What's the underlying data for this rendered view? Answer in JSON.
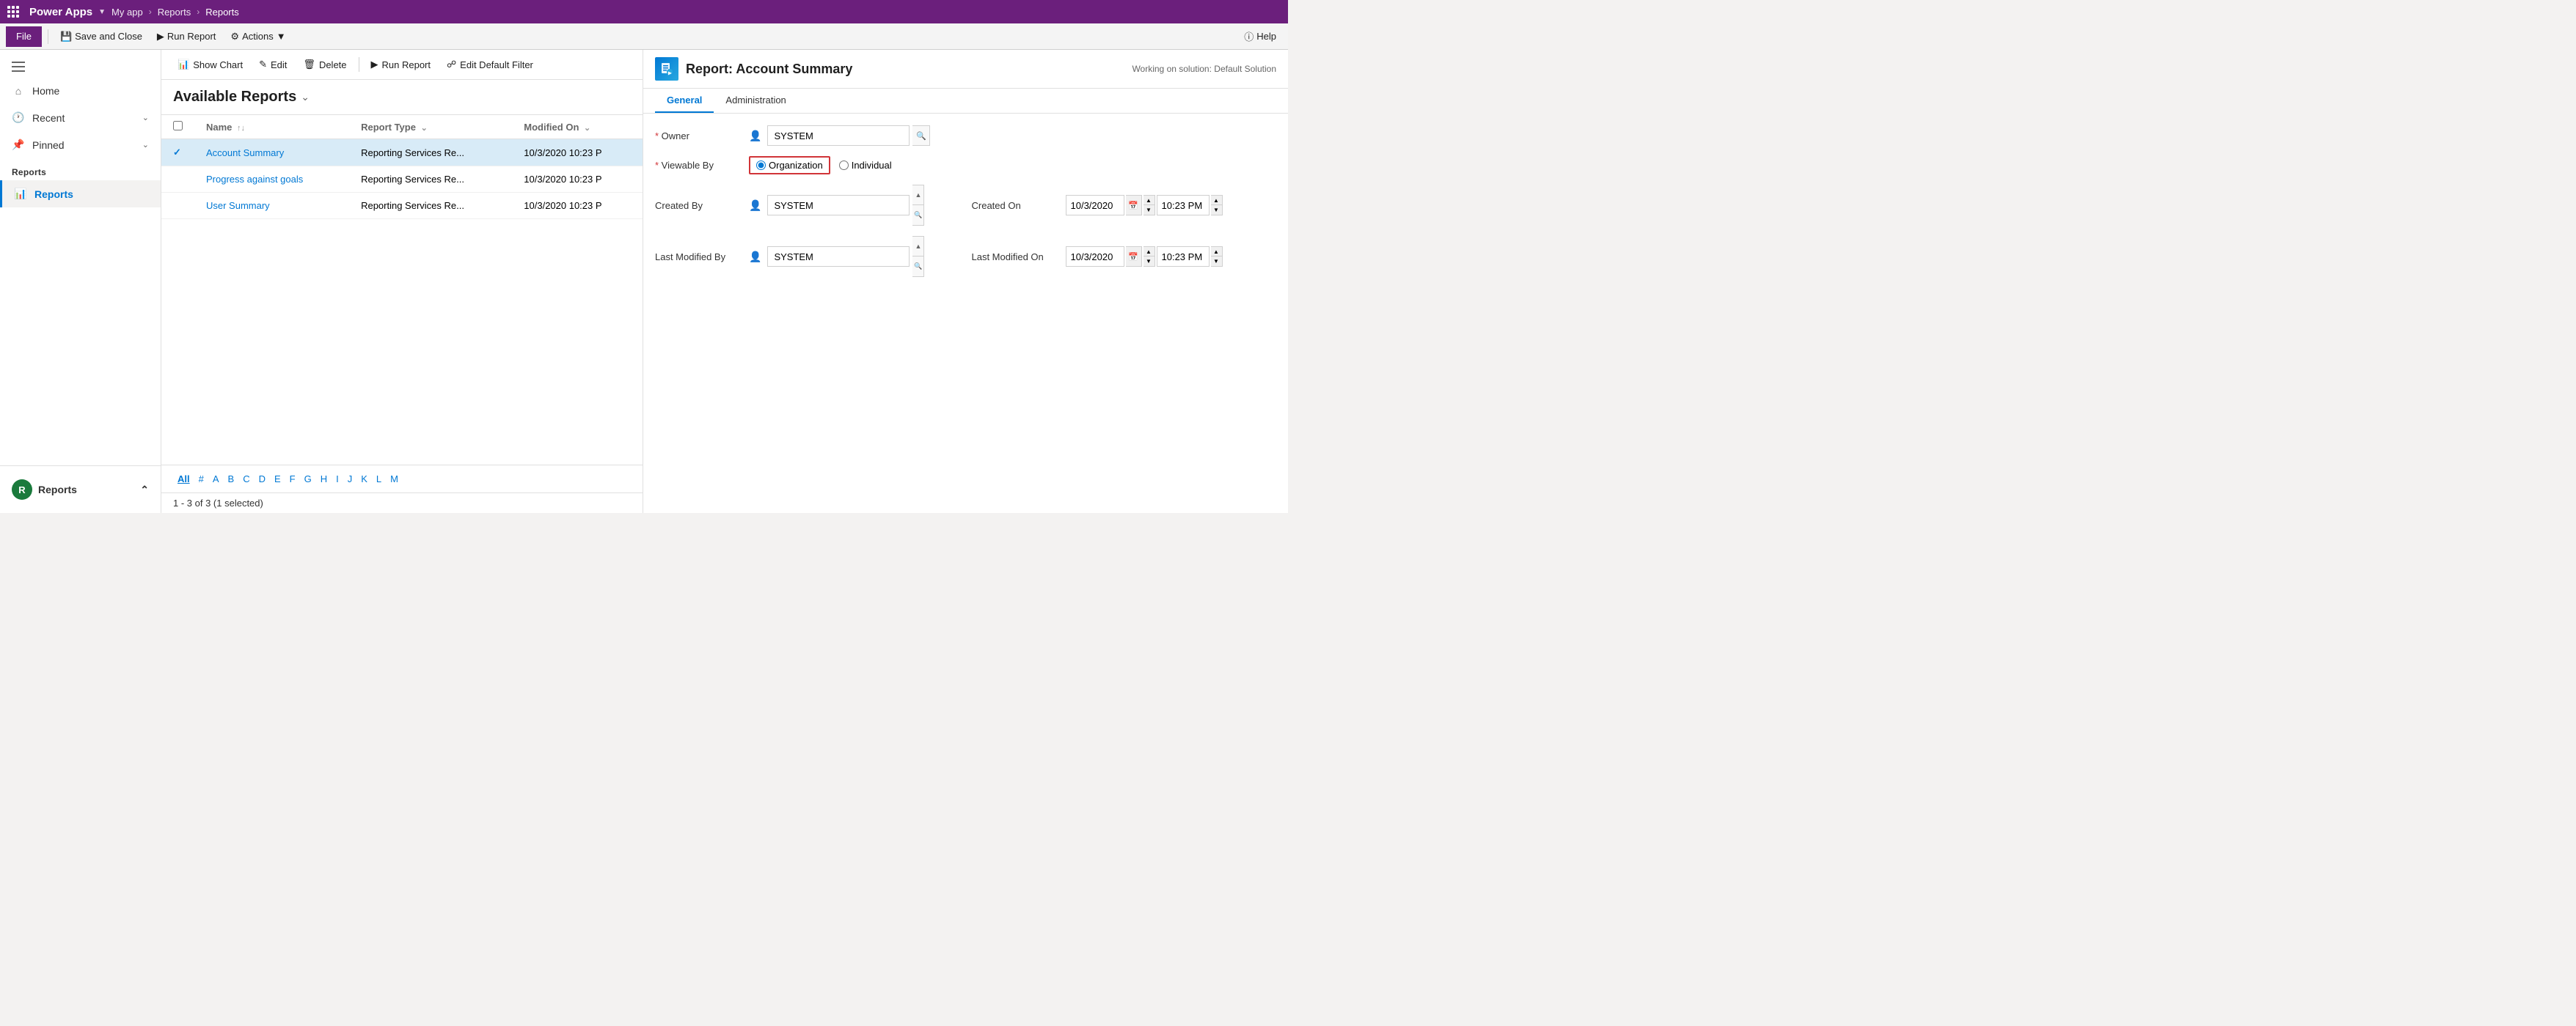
{
  "topNav": {
    "appName": "Power Apps",
    "myApp": "My app",
    "breadcrumb1": "Reports",
    "breadcrumb2": "Reports"
  },
  "toolbar": {
    "fileLabel": "File",
    "saveAndClose": "Save and Close",
    "runReport": "Run Report",
    "actions": "Actions",
    "helpLabel": "Help"
  },
  "listToolbar": {
    "showChart": "Show Chart",
    "edit": "Edit",
    "delete": "Delete",
    "runReport": "Run Report",
    "editDefaultFilter": "Edit Default Filter"
  },
  "tableSection": {
    "title": "Available Reports",
    "columns": {
      "name": "Name",
      "reportType": "Report Type",
      "modifiedOn": "Modified On"
    },
    "rows": [
      {
        "name": "Account Summary",
        "reportType": "Reporting Services Re...",
        "modifiedOn": "10/3/2020 10:23 P",
        "selected": true
      },
      {
        "name": "Progress against goals",
        "reportType": "Reporting Services Re...",
        "modifiedOn": "10/3/2020 10:23 P",
        "selected": false
      },
      {
        "name": "User Summary",
        "reportType": "Reporting Services Re...",
        "modifiedOn": "10/3/2020 10:23 P",
        "selected": false
      }
    ],
    "statusText": "1 - 3 of 3 (1 selected)"
  },
  "alphaNav": [
    "All",
    "#",
    "A",
    "B",
    "C",
    "D",
    "E",
    "F",
    "G",
    "H",
    "I",
    "J",
    "K",
    "L",
    "M"
  ],
  "sidebar": {
    "homeLabel": "Home",
    "recentLabel": "Recent",
    "pinnedLabel": "Pinned",
    "sectionLabel": "Reports",
    "reportsLabel": "Reports",
    "bottomReportsLabel": "Reports"
  },
  "rightPanel": {
    "title": "Report: Account Summary",
    "workingOn": "Working on solution: Default Solution",
    "tabs": [
      "General",
      "Administration"
    ],
    "form": {
      "ownerLabel": "Owner",
      "ownerValue": "SYSTEM",
      "viewableByLabel": "Viewable By",
      "organizationOption": "Organization",
      "individualOption": "Individual",
      "createdByLabel": "Created By",
      "createdByValue": "SYSTEM",
      "createdOnLabel": "Created On",
      "createdOnDate": "10/3/2020",
      "createdOnTime": "10:23 PM",
      "lastModifiedByLabel": "Last Modified By",
      "lastModifiedByValue": "SYSTEM",
      "lastModifiedOnLabel": "Last Modified On",
      "lastModifiedOnDate": "10/3/2020",
      "lastModifiedOnTime": "10:23 PM"
    }
  }
}
